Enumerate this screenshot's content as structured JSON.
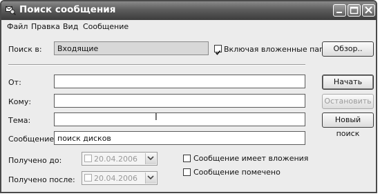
{
  "window": {
    "title": "Поиск сообщения"
  },
  "menu": [
    "Файл",
    "Правка",
    "Вид",
    "Сообщение"
  ],
  "search_in": {
    "label": "Поиск в:",
    "value": "Входящие"
  },
  "include_subfolders": {
    "label": "Включая вложенные папки",
    "checked": true
  },
  "browse_button": "Обзор..",
  "fields": {
    "from": {
      "label": "От:",
      "value": ""
    },
    "to": {
      "label": "Кому:",
      "value": ""
    },
    "subject": {
      "label": "Тема:",
      "value": ""
    },
    "message": {
      "label": "Сообщение:",
      "value": "поиск дисков"
    }
  },
  "buttons": {
    "start": "Начать поиск",
    "stop": "Остановить",
    "new": "Новый поиск"
  },
  "received_before": {
    "label": "Получено до:",
    "value": "20.04.2006"
  },
  "received_after": {
    "label": "Получено после:",
    "value": "20.04.2006"
  },
  "has_attachments": {
    "label": "Сообщение имеет вложения",
    "checked": false
  },
  "flagged": {
    "label": "Сообщение помечено",
    "checked": false
  }
}
